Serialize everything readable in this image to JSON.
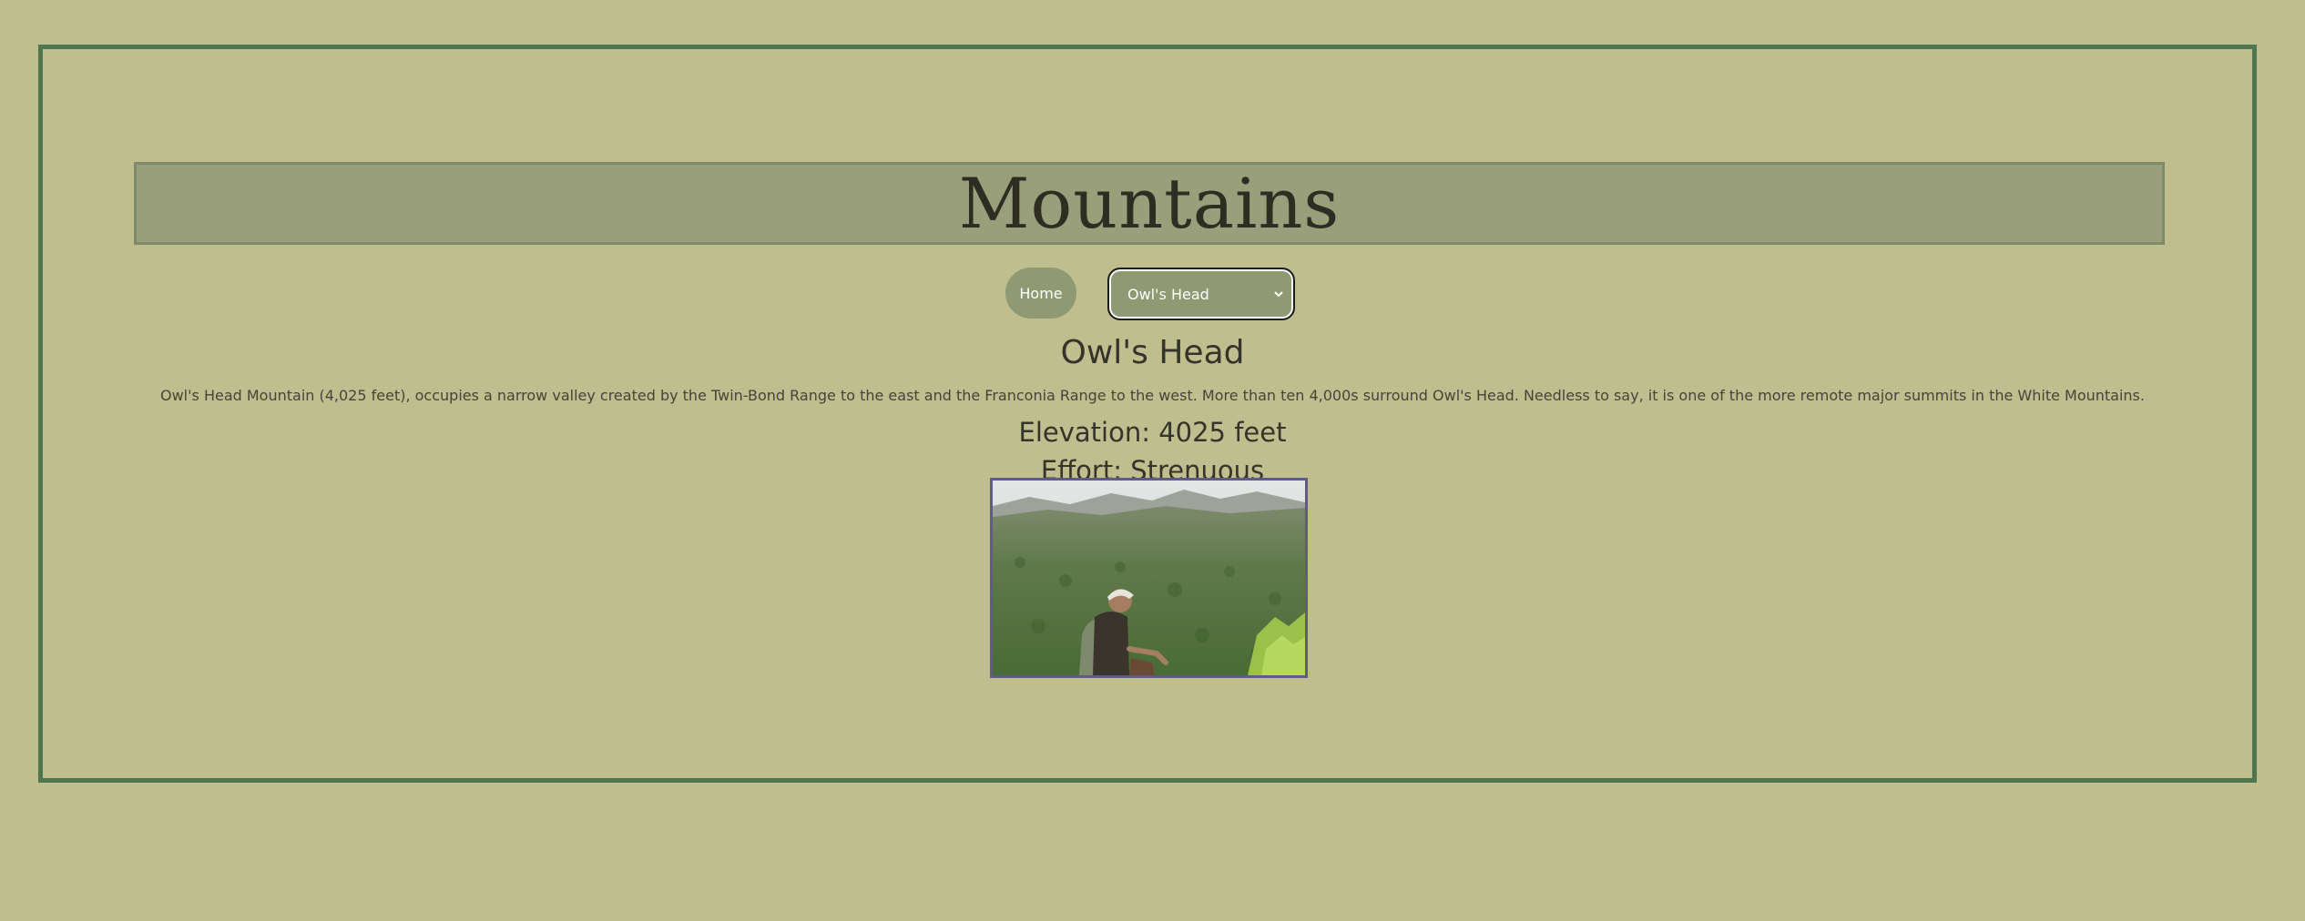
{
  "header": {
    "title": "Mountains"
  },
  "nav": {
    "home_label": "Home",
    "select_value": "Owl's Head"
  },
  "peak": {
    "name": "Owl's Head",
    "description": "Owl's Head Mountain (4,025 feet), occupies a narrow valley created by the Twin-Bond Range to the east and the Franconia Range to the west. More than ten 4,000s surround Owl's Head. Needless to say, it is one of the more remote major summits in the White Mountains.",
    "elevation": "Elevation: 4025 feet",
    "effort": "Effort: Strenuous"
  },
  "icons": {
    "select_chevron": "chevron-down-icon"
  },
  "colors": {
    "page_background": "#bfbe8f",
    "frame_border": "#4e774e",
    "title_bar": "#999f7b",
    "button_background": "#8f9972",
    "photo_border": "#5e5c86"
  }
}
